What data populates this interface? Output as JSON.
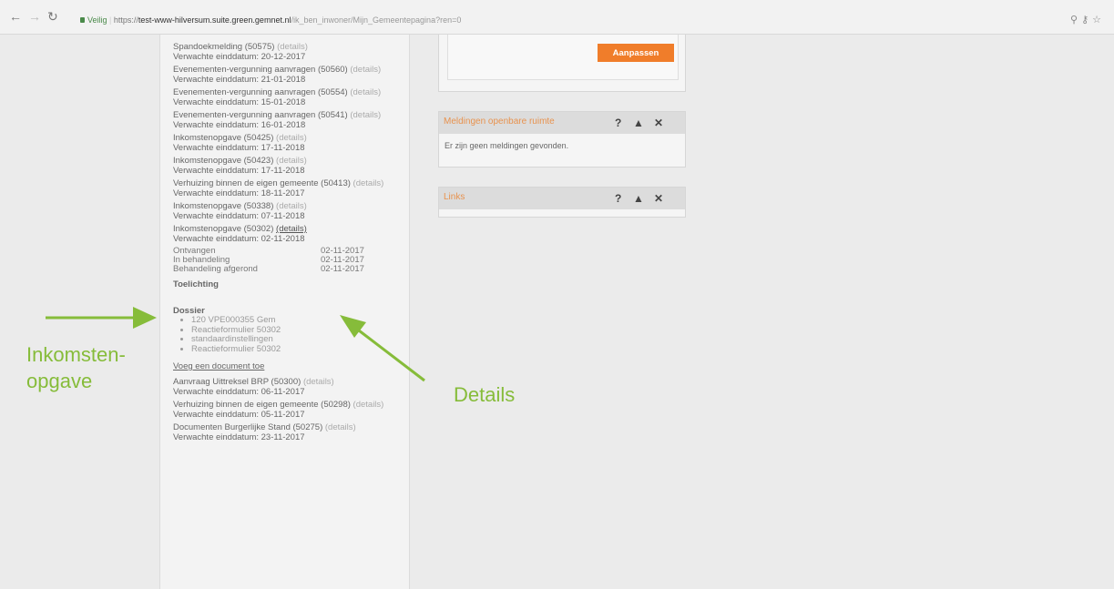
{
  "browser": {
    "secure_label": "Veilig",
    "url_scheme": "https://",
    "url_host": "test-www-hilversum.suite.green.gemnet.nl",
    "url_path": "/ik_ben_inwoner/Mijn_Gemeentepagina?ren=0"
  },
  "left_panel": {
    "items_top": [
      {
        "title": "Spandoekmelding (50575)",
        "details": "(details)",
        "date_label": "Verwachte einddatum: 20-12-2017"
      },
      {
        "title": "Evenementen-vergunning aanvragen (50560)",
        "details": "(details)",
        "date_label": "Verwachte einddatum: 21-01-2018"
      },
      {
        "title": "Evenementen-vergunning aanvragen (50554)",
        "details": "(details)",
        "date_label": "Verwachte einddatum: 15-01-2018"
      },
      {
        "title": "Evenementen-vergunning aanvragen (50541)",
        "details": "(details)",
        "date_label": "Verwachte einddatum: 16-01-2018"
      },
      {
        "title": "Inkomstenopgave (50425)",
        "details": "(details)",
        "date_label": "Verwachte einddatum: 17-11-2018"
      },
      {
        "title": "Inkomstenopgave (50423)",
        "details": "(details)",
        "date_label": "Verwachte einddatum: 17-11-2018"
      },
      {
        "title": "Verhuizing binnen de eigen gemeente (50413)",
        "details": "(details)",
        "date_label": "Verwachte einddatum: 18-11-2017"
      },
      {
        "title": "Inkomstenopgave (50338)",
        "details": "(details)",
        "date_label": "Verwachte einddatum: 07-11-2018"
      }
    ],
    "expanded_item": {
      "title": "Inkomstenopgave (50302)",
      "details": "(details)",
      "date_label": "Verwachte einddatum: 02-11-2018",
      "status": [
        {
          "label": "Ontvangen",
          "date": "02-11-2017"
        },
        {
          "label": "In behandeling",
          "date": "02-11-2017"
        },
        {
          "label": "Behandeling afgerond",
          "date": "02-11-2017"
        }
      ],
      "toelichting": "Toelichting",
      "dossier_title": "Dossier",
      "documents": [
        "120 VPE000355 Gem",
        "Reactieformulier 50302",
        "standaardinstellingen",
        "Reactieformulier 50302"
      ],
      "add_document": "Voeg een document toe"
    },
    "items_bottom": [
      {
        "title": "Aanvraag Uittreksel BRP (50300)",
        "details": "(details)",
        "date_label": "Verwachte einddatum: 06-11-2017"
      },
      {
        "title": "Verhuizing binnen de eigen gemeente (50298)",
        "details": "(details)",
        "date_label": "Verwachte einddatum: 05-11-2017"
      },
      {
        "title": "Documenten Burgerlijke Stand (50275)",
        "details": "(details)",
        "date_label": "Verwachte einddatum: 23-11-2017"
      }
    ]
  },
  "right": {
    "button_label": "Aanpassen",
    "widget_meldingen": {
      "title": "Meldingen openbare ruimte",
      "help": "?",
      "up": "▲",
      "close": "✕",
      "body": "Er zijn geen meldingen gevonden."
    },
    "widget_links": {
      "title": "Links",
      "help": "?",
      "up": "▲",
      "close": "✕"
    }
  },
  "annotations": {
    "left_label_1": "Inkomsten-",
    "left_label_2": "opgave",
    "right_label": "Details",
    "color": "#86bc3a"
  }
}
